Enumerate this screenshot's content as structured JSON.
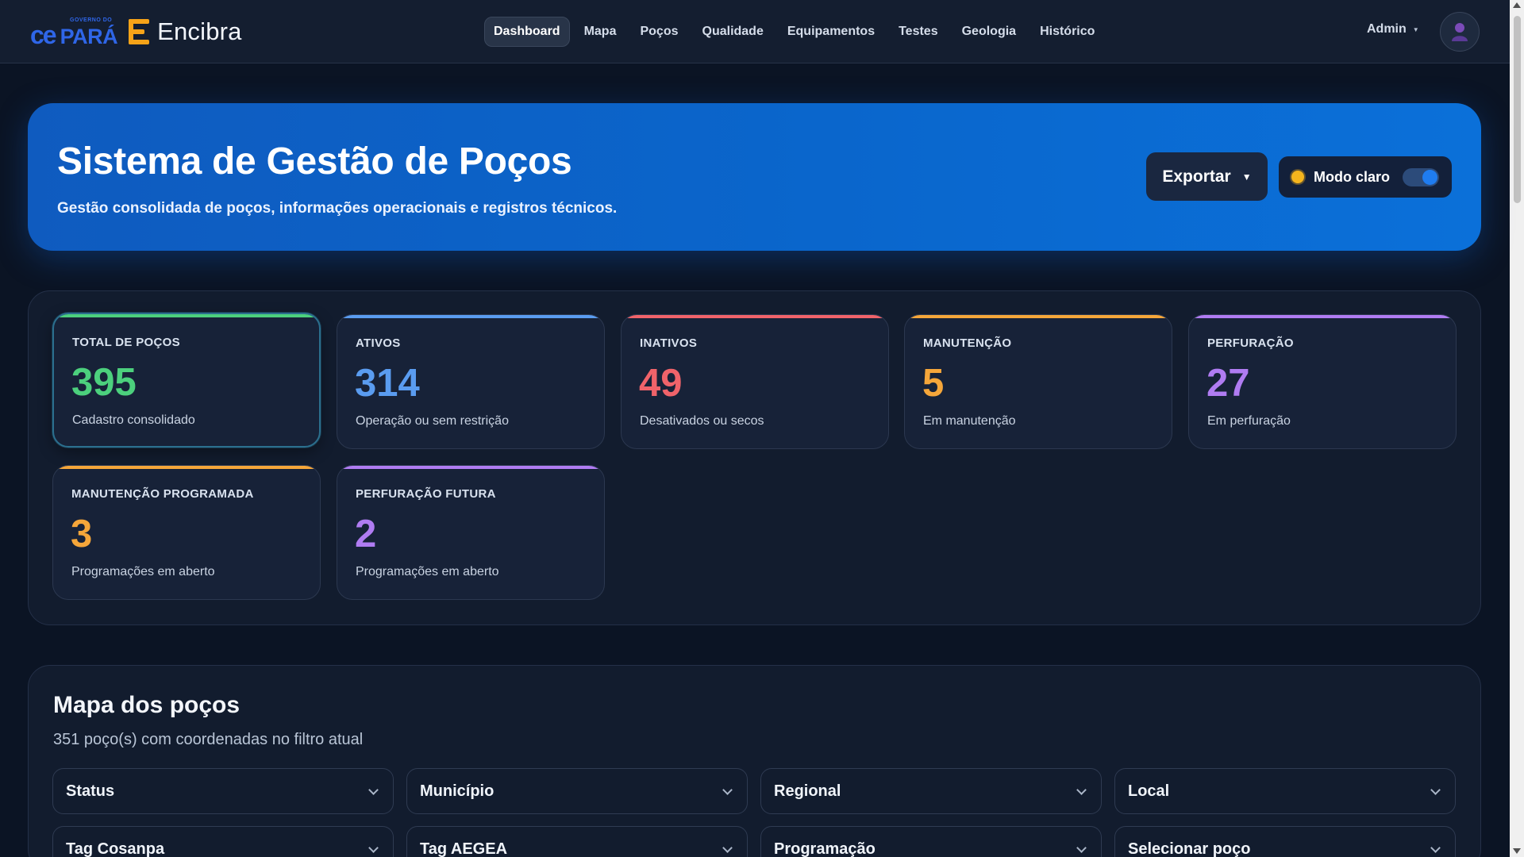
{
  "brand": {
    "partner_mark": "ce",
    "partner_word": "PARÁ",
    "partner_tiny": "GOVERNO DO",
    "name": "Encibra",
    "colors": {
      "partner": "#2f66e8",
      "logo": "#f6a318"
    }
  },
  "nav": {
    "items": [
      {
        "label": "Dashboard",
        "active": true
      },
      {
        "label": "Mapa"
      },
      {
        "label": "Poços"
      },
      {
        "label": "Qualidade"
      },
      {
        "label": "Equipamentos"
      },
      {
        "label": "Testes"
      },
      {
        "label": "Geologia"
      },
      {
        "label": "Histórico"
      }
    ],
    "user": "Admin"
  },
  "hero": {
    "title": "Sistema de Gestão de Poços",
    "subtitle": "Gestão consolidada de poços, informações operacionais e registros técnicos.",
    "export_label": "Exportar",
    "mode_label": "Modo claro",
    "mode_on": true
  },
  "stats": [
    {
      "label": "TOTAL DE POÇOS",
      "value": "395",
      "desc": "Cadastro consolidado",
      "color": "#4cd07d"
    },
    {
      "label": "ATIVOS",
      "value": "314",
      "desc": "Operação ou sem restrição",
      "color": "#5a9cf0"
    },
    {
      "label": "INATIVOS",
      "value": "49",
      "desc": "Desativados ou secos",
      "color": "#f0636a"
    },
    {
      "label": "MANUTENÇÃO",
      "value": "5",
      "desc": "Em manutenção",
      "color": "#f5a63a"
    },
    {
      "label": "PERFURAÇÃO",
      "value": "27",
      "desc": "Em perfuração",
      "color": "#b07cf2"
    },
    {
      "label": "MANUTENÇÃO PROGRAMADA",
      "value": "3",
      "desc": "Programações em aberto",
      "color": "#f5a63a"
    },
    {
      "label": "PERFURAÇÃO FUTURA",
      "value": "2",
      "desc": "Programações em aberto",
      "color": "#b07cf2"
    }
  ],
  "map": {
    "title": "Mapa dos poços",
    "subtitle": "351 poço(s) com coordenadas no filtro atual",
    "filters": [
      "Status",
      "Município",
      "Regional",
      "Local",
      "Tag Cosanpa",
      "Tag AEGEA",
      "Programação",
      "Selecionar poço"
    ]
  }
}
